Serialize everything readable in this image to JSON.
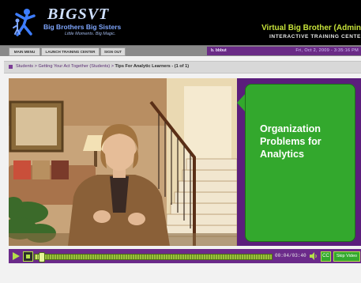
{
  "header": {
    "logo_title": "BIGSVT",
    "logo_subtitle": "Big Brothers Big Sisters",
    "logo_tagline": "Little Moments. Big Magic.",
    "app_title": "Virtual Big Brother (Admin",
    "app_subtitle": "INTERACTIVE TRAINING CENTE"
  },
  "nav": {
    "main_menu": "MAIN MENU",
    "launch_training": "LAUNCH TRAINING CENTER",
    "sign_out": "SIGN OUT"
  },
  "user": {
    "name": "b. bbbut",
    "datetime": "Fri, Oct 2, 2009 - 3:35:16 PM"
  },
  "breadcrumb": {
    "path": "Students > Getting Your Act Together (Students) > ",
    "current": "Tips For Analytic Learners - (1 of 1)"
  },
  "slide": {
    "title": "Organization Problems for Analytics"
  },
  "player": {
    "time": "00:04/03:40",
    "progress": 0.02,
    "skip_label": "Skip Video",
    "cc_label": "CC"
  },
  "colors": {
    "accent_green": "#33a82d",
    "panel_purple": "#5b1e7c",
    "controls_purple": "#6b2a8a",
    "header_yellow": "#c6e23a"
  }
}
